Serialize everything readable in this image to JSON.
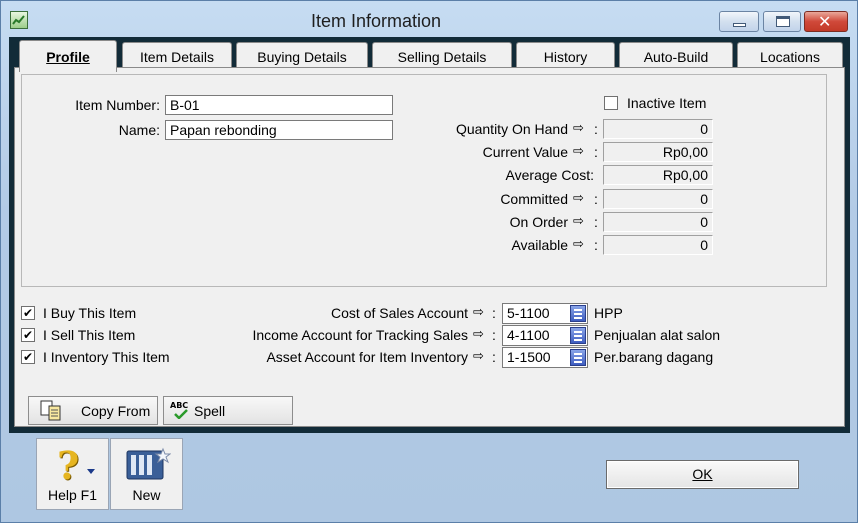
{
  "window": {
    "title": "Item Information"
  },
  "tabs": [
    {
      "label": "Profile",
      "active": true
    },
    {
      "label": "Item Details",
      "active": false
    },
    {
      "label": "Buying Details",
      "active": false
    },
    {
      "label": "Selling Details",
      "active": false
    },
    {
      "label": "History",
      "active": false
    },
    {
      "label": "Auto-Build",
      "active": false
    },
    {
      "label": "Locations",
      "active": false
    }
  ],
  "profile": {
    "item_number_label": "Item Number:",
    "item_number_value": "B-01",
    "name_label": "Name:",
    "name_value": "Papan rebonding",
    "inactive_label": "Inactive Item",
    "inactive_checked": false,
    "stats": [
      {
        "label": "Quantity On Hand",
        "has_arrow": true,
        "value": "0"
      },
      {
        "label": "Current Value",
        "has_arrow": true,
        "value": "Rp0,00"
      },
      {
        "label": "Average Cost:",
        "has_arrow": false,
        "value": "Rp0,00"
      },
      {
        "label": "Committed",
        "has_arrow": true,
        "value": "0"
      },
      {
        "label": "On Order",
        "has_arrow": true,
        "value": "0"
      },
      {
        "label": "Available",
        "has_arrow": true,
        "value": "0"
      }
    ],
    "checkboxes": [
      {
        "label": "I Buy This Item",
        "checked": true
      },
      {
        "label": "I Sell This Item",
        "checked": true
      },
      {
        "label": "I Inventory This Item",
        "checked": true
      }
    ],
    "accounts": [
      {
        "label": "Cost of Sales Account",
        "code": "5-1100",
        "name": "HPP"
      },
      {
        "label": "Income Account for Tracking Sales",
        "code": "4-1100",
        "name": "Penjualan alat salon"
      },
      {
        "label": "Asset Account for Item Inventory",
        "code": "1-1500",
        "name": "Per.barang dagang"
      }
    ],
    "copy_from_label": "Copy From",
    "spell_label": "Spell",
    "spell_icon_text": "ABC"
  },
  "footer": {
    "help_label": "Help F1",
    "new_label": "New",
    "ok_label": "OK"
  }
}
